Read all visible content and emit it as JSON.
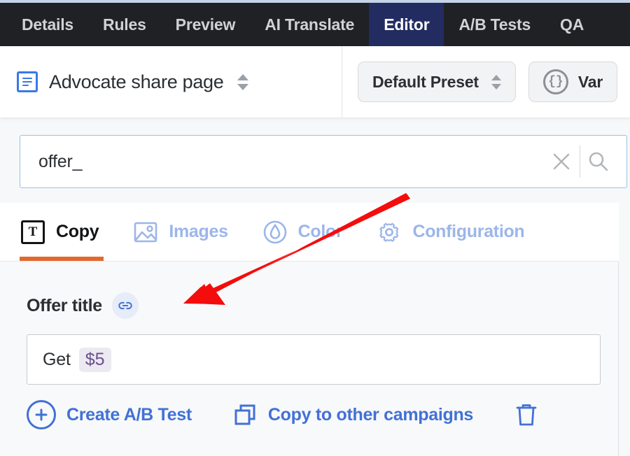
{
  "topnav": {
    "items": [
      {
        "label": "Details",
        "active": false
      },
      {
        "label": "Rules",
        "active": false
      },
      {
        "label": "Preview",
        "active": false
      },
      {
        "label": "AI Translate",
        "active": false
      },
      {
        "label": "Editor",
        "active": true
      },
      {
        "label": "A/B Tests",
        "active": false
      },
      {
        "label": "QA",
        "active": false
      }
    ],
    "active_bg": "#222c60",
    "bg": "#202124"
  },
  "header": {
    "page_title": "Advocate share page",
    "page_icon": "document-icon",
    "stepper_icon": "up-down-chevrons-icon",
    "preset": {
      "label": "Default Preset",
      "stepper_icon": "up-down-chevrons-icon"
    },
    "variables": {
      "label": "Var",
      "icon": "curly-braces-circle-icon"
    }
  },
  "search": {
    "value": "offer_",
    "placeholder": "Search",
    "clear_icon": "close-icon",
    "search_icon": "magnifier-icon",
    "border_color": "#9cc0ea"
  },
  "tabs": {
    "items": [
      {
        "label": "Copy",
        "icon": "text-box-icon",
        "active": true
      },
      {
        "label": "Images",
        "icon": "image-icon",
        "active": false
      },
      {
        "label": "Color",
        "icon": "droplet-circle-icon",
        "active": false
      },
      {
        "label": "Configuration",
        "icon": "gear-icon",
        "active": false
      }
    ],
    "active_underline_color": "#e2692c",
    "inactive_color": "#9cb6ea"
  },
  "field": {
    "label": "Offer title",
    "link_icon": "link-icon",
    "value_prefix": "Get",
    "value_token": "$5",
    "token_color": "#6b4f8f"
  },
  "actions": {
    "create_ab_test": {
      "label": "Create A/B Test",
      "icon": "plus-circle-icon"
    },
    "copy_to_campaigns": {
      "label": "Copy to other campaigns",
      "icon": "copy-icon"
    },
    "delete": {
      "label": "",
      "icon": "trash-icon"
    },
    "color": "#4271d6"
  },
  "annotation": {
    "type": "arrow",
    "color": "#f50c0c",
    "points_at": "link-icon"
  }
}
